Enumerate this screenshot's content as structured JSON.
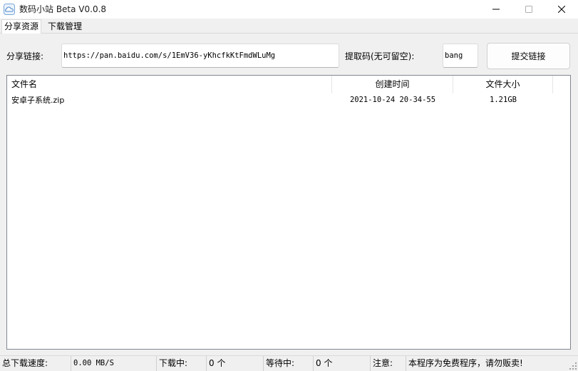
{
  "window": {
    "title": "数码小站 Beta V0.0.8",
    "controls": {
      "minimize": "minimize-icon",
      "maximize": "maximize-icon",
      "close": "close-icon"
    }
  },
  "tabs": [
    {
      "label": "分享资源",
      "active": true
    },
    {
      "label": "下载管理",
      "active": false
    }
  ],
  "form": {
    "share_link_label": "分享链接:",
    "share_link_value": "https://pan.baidu.com/s/1EmV36-yKhcfkKtFmdWLuMg",
    "code_label": "提取码(无可留空):",
    "code_value": "bang",
    "submit_label": "提交链接"
  },
  "file_list": {
    "columns": [
      "文件名",
      "创建时间",
      "文件大小"
    ],
    "rows": [
      {
        "name": "安卓子系统.zip",
        "created": "2021-10-24 20-34-55",
        "size": "1.21GB"
      }
    ]
  },
  "statusbar": {
    "total_speed_label": "总下载速度:",
    "total_speed_value": "0.00 MB/S",
    "downloading_label": "下载中:",
    "downloading_value": "0 个",
    "waiting_label": "等待中:",
    "waiting_value": "0 个",
    "notice_label": "注意:",
    "notice_value": "本程序为免费程序，请勿贩卖!"
  },
  "colors": {
    "window_bg": "#f0f0f0",
    "list_border": "#828790",
    "titlebar_bg": "#ffffff"
  }
}
